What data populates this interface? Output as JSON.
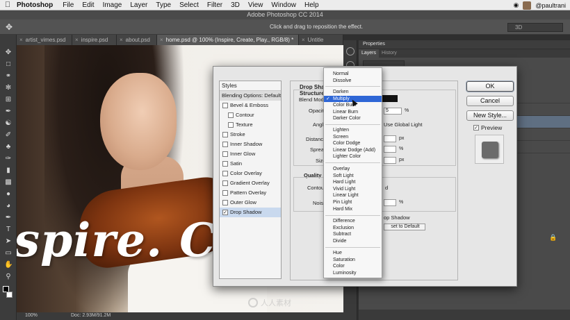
{
  "menubar": {
    "app": "Photoshop",
    "items": [
      "File",
      "Edit",
      "Image",
      "Layer",
      "Type",
      "Select",
      "Filter",
      "3D",
      "View",
      "Window",
      "Help"
    ],
    "user": "@paultrani"
  },
  "window_title": "Adobe Photoshop CC 2014",
  "options_bar": {
    "hint": "Click and drag to reposition the effect.",
    "workspace": "3D"
  },
  "tabs": [
    {
      "label": "artist_vimes.psd",
      "active": false
    },
    {
      "label": "inspire.psd",
      "active": false
    },
    {
      "label": "about.psd",
      "active": false
    },
    {
      "label": "home.psd @ 100% (Inspire, Create, Play., RGB/8) *",
      "active": true
    },
    {
      "label": "Untitle",
      "active": false
    }
  ],
  "canvas": {
    "headline": "spire. Cre"
  },
  "status": {
    "zoom": "100%",
    "doc": "Doc: 2.93M/91.2M"
  },
  "panels": {
    "properties": "Properties",
    "layers_tab": "Layers",
    "history_tab": "History"
  },
  "dialog": {
    "styles_header": "Styles",
    "blending_options": "Blending Options: Default",
    "styles": [
      {
        "label": "Bevel & Emboss",
        "checked": false,
        "sub": false
      },
      {
        "label": "Contour",
        "checked": false,
        "sub": true
      },
      {
        "label": "Texture",
        "checked": false,
        "sub": true
      },
      {
        "label": "Stroke",
        "checked": false,
        "sub": false
      },
      {
        "label": "Inner Shadow",
        "checked": false,
        "sub": false
      },
      {
        "label": "Inner Glow",
        "checked": false,
        "sub": false
      },
      {
        "label": "Satin",
        "checked": false,
        "sub": false
      },
      {
        "label": "Color Overlay",
        "checked": false,
        "sub": false
      },
      {
        "label": "Gradient Overlay",
        "checked": false,
        "sub": false
      },
      {
        "label": "Pattern Overlay",
        "checked": false,
        "sub": false
      },
      {
        "label": "Outer Glow",
        "checked": false,
        "sub": false
      },
      {
        "label": "Drop Shadow",
        "checked": true,
        "sub": false,
        "selected": true
      }
    ],
    "section_title_1": "Drop Shado",
    "section_title_2": "Structure",
    "blend_mode_label": "Blend Mode",
    "opacity_label": "Opacity",
    "opacity_value": "5",
    "angle_label": "Angle",
    "use_global_light": "Use Global Light",
    "distance_label": "Distance",
    "spread_label": "Spread",
    "size_label": "Size",
    "px": "px",
    "percent": "%",
    "quality_label": "Quality",
    "contour_label": "Contour",
    "noise_label": "Noise",
    "anti_aliased_tail": "d",
    "knockout_tail": "op Shadow",
    "reset_label": "set to Default",
    "ok": "OK",
    "cancel": "Cancel",
    "new_style": "New Style...",
    "preview": "Preview"
  },
  "blend_modes": {
    "selected": "Multiply",
    "groups": [
      [
        "Normal",
        "Dissolve"
      ],
      [
        "Darken",
        "Multiply",
        "Color Burn",
        "Linear Burn",
        "Darker Color"
      ],
      [
        "Lighten",
        "Screen",
        "Color Dodge",
        "Linear Dodge (Add)",
        "Lighter Color"
      ],
      [
        "Overlay",
        "Soft Light",
        "Hard Light",
        "Vivid Light",
        "Linear Light",
        "Pin Light",
        "Hard Mix"
      ],
      [
        "Difference",
        "Exclusion",
        "Subtract",
        "Divide"
      ],
      [
        "Hue",
        "Saturation",
        "Color",
        "Luminosity"
      ]
    ]
  },
  "watermark": "人人素材"
}
